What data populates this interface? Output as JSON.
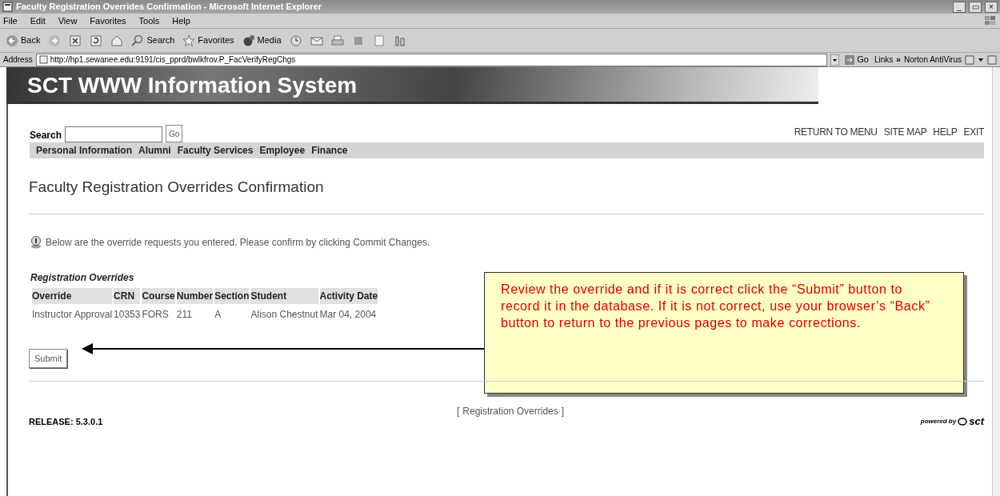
{
  "window": {
    "title": "Faculty Registration Overrides Confirmation - Microsoft Internet Explorer",
    "controls": [
      "_",
      "▭",
      "×"
    ]
  },
  "menu": [
    "File",
    "Edit",
    "View",
    "Favorites",
    "Tools",
    "Help"
  ],
  "toolbar": [
    {
      "kind": "back",
      "label": "Back"
    },
    {
      "kind": "forward"
    },
    {
      "kind": "stop"
    },
    {
      "kind": "refresh"
    },
    {
      "kind": "home"
    },
    {
      "kind": "search",
      "label": "Search"
    },
    {
      "kind": "favorites",
      "label": "Favorites"
    },
    {
      "kind": "media",
      "label": "Media"
    },
    {
      "kind": "history"
    },
    {
      "kind": "mail"
    },
    {
      "kind": "print"
    },
    {
      "kind": "edit"
    },
    {
      "kind": "page"
    },
    {
      "kind": "tool"
    }
  ],
  "address": {
    "label": "Address",
    "url": "http://hp1.sewanee.edu:9191/cis_pprd/bwlkfrov.P_FacVerifyRegChgs",
    "go": "Go",
    "links": "Links",
    "chevron": "»",
    "addon": "Norton AntiVirus"
  },
  "banner": {
    "title": "SCT WWW Information System"
  },
  "search": {
    "label": "Search",
    "button": "Go"
  },
  "top_links": [
    "RETURN TO MENU",
    "SITE MAP",
    "HELP",
    "EXIT"
  ],
  "tabs": [
    {
      "label": "Personal Information",
      "selected": false
    },
    {
      "label": "Alumni",
      "selected": false
    },
    {
      "label": "Faculty Services",
      "selected": false
    },
    {
      "label": "Employee",
      "selected": false
    },
    {
      "label": "Finance",
      "selected": false
    }
  ],
  "page_title": "Faculty Registration Overrides Confirmation",
  "info": "Below are the override requests you entered. Please confirm by clicking Commit Changes.",
  "table": {
    "caption": "Registration Overrides",
    "columns": [
      "Override",
      "CRN",
      "Course",
      "Number",
      "Section",
      "Student",
      "Activity Date"
    ],
    "rows": [
      [
        "Instructor Approval",
        "10353",
        "FORS",
        "211",
        "A",
        "Alison Chestnut",
        "Mar 04, 2004"
      ]
    ]
  },
  "submit": "Submit",
  "callout": "Review the override and if it is correct click the “Submit” button to record it in the database.  If it is not correct, use your browser’s “Back” button to return to the previous pages to make corrections.",
  "footer": {
    "release": "RELEASE: 5.3.0.1",
    "link_open": "[",
    "link": "Registration Overrides",
    "link_close": "]",
    "logo_prefix": "powered by",
    "logo_mark": "sct"
  }
}
